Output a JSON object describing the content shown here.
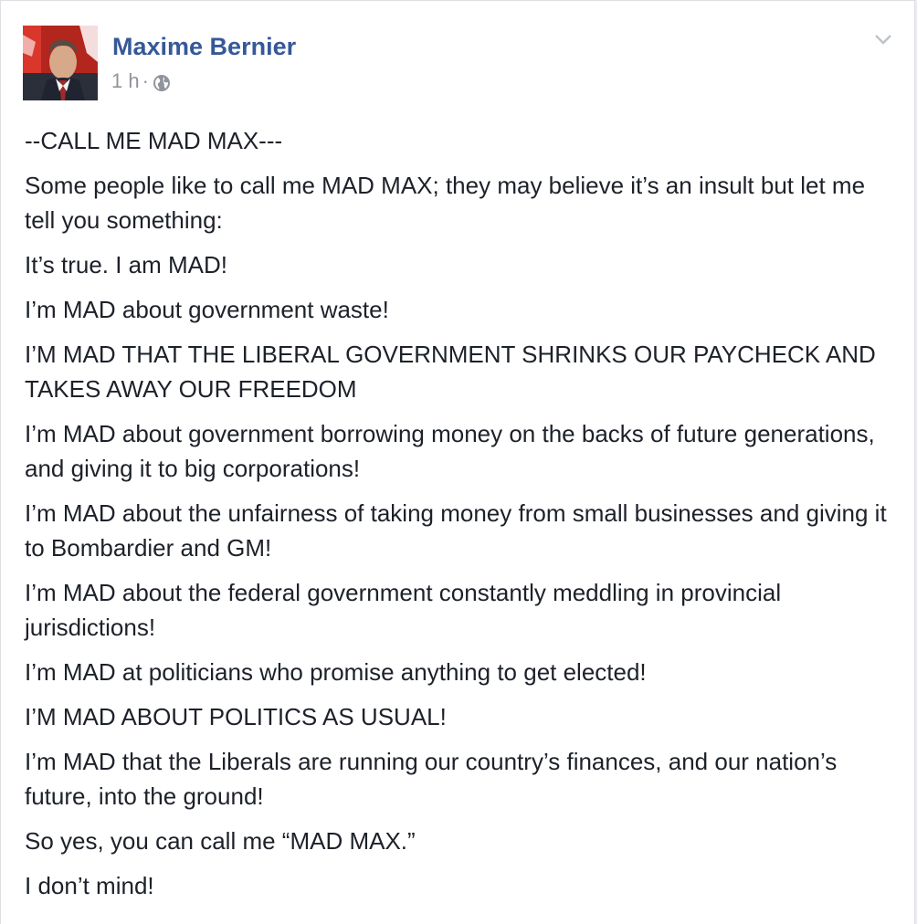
{
  "post": {
    "author": "Maxime Bernier",
    "timestamp": "1 h",
    "separator": "·",
    "audience_icon": "globe-icon",
    "menu_icon": "chevron-down-icon",
    "avatar_icon": "profile-photo",
    "paragraphs": [
      "--CALL ME MAD MAX---",
      "Some people like to call me MAD MAX; they may believe it’s an insult but let me tell you something:",
      "It’s true. I am MAD!",
      "I’m MAD about government waste!",
      "I’M MAD THAT THE LIBERAL GOVERNMENT SHRINKS OUR PAYCHECK AND TAKES AWAY OUR FREEDOM",
      "I’m MAD about government borrowing money on the backs of future generations, and giving it to big corporations!",
      "I’m MAD about the unfairness of taking money from small businesses and giving it to Bombardier and GM!",
      "I’m MAD about the federal government constantly meddling in provincial jurisdictions!",
      "I’m MAD at politicians who promise anything to get elected!",
      "I’M MAD ABOUT POLITICS AS USUAL!",
      "I’m MAD that the Liberals are running our country’s finances, and our nation’s future, into the ground!",
      "So yes, you can call me “MAD MAX.”",
      "I don’t mind!"
    ]
  },
  "colors": {
    "author_link": "#365899",
    "meta_text": "#90949c",
    "body_text": "#1d2129",
    "background": "#ffffff"
  }
}
